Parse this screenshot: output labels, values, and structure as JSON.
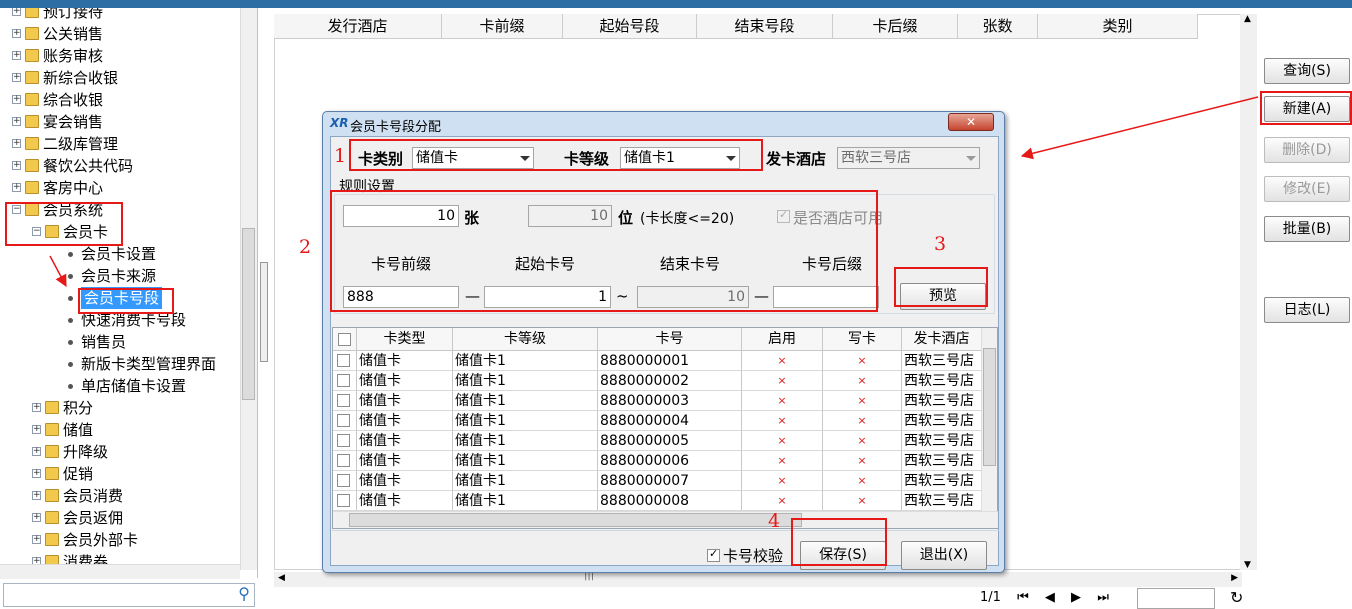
{
  "tree": {
    "items": [
      {
        "label": "预订接待",
        "kind": "folder"
      },
      {
        "label": "公关销售",
        "kind": "folder"
      },
      {
        "label": "账务审核",
        "kind": "folder"
      },
      {
        "label": "新综合收银",
        "kind": "folder"
      },
      {
        "label": "综合收银",
        "kind": "folder"
      },
      {
        "label": "宴会销售",
        "kind": "folder"
      },
      {
        "label": "二级库管理",
        "kind": "folder"
      },
      {
        "label": "餐饮公共代码",
        "kind": "folder"
      },
      {
        "label": "客房中心",
        "kind": "folder"
      },
      {
        "label": "会员系统",
        "kind": "folder"
      },
      {
        "label": "会员卡",
        "kind": "folder"
      },
      {
        "label": "会员卡设置",
        "kind": "leaf"
      },
      {
        "label": "会员卡来源",
        "kind": "leaf"
      },
      {
        "label": "会员卡号段",
        "kind": "leaf"
      },
      {
        "label": "快速消费卡号段",
        "kind": "leaf"
      },
      {
        "label": "销售员",
        "kind": "leaf"
      },
      {
        "label": "新版卡类型管理界面",
        "kind": "leaf"
      },
      {
        "label": "单店储值卡设置",
        "kind": "leaf"
      },
      {
        "label": "积分",
        "kind": "folder"
      },
      {
        "label": "储值",
        "kind": "folder"
      },
      {
        "label": "升降级",
        "kind": "folder"
      },
      {
        "label": "促销",
        "kind": "folder"
      },
      {
        "label": "会员消费",
        "kind": "folder"
      },
      {
        "label": "会员返佣",
        "kind": "folder"
      },
      {
        "label": "会员外部卡",
        "kind": "folder"
      },
      {
        "label": "消费券",
        "kind": "folder"
      }
    ],
    "search_placeholder": ""
  },
  "grid": {
    "columns": [
      "发行酒店",
      "卡前缀",
      "起始号段",
      "结束号段",
      "卡后缀",
      "张数",
      "类别"
    ]
  },
  "side_buttons": {
    "query": "查询(S)",
    "new": "新建(A)",
    "delete": "删除(D)",
    "modify": "修改(E)",
    "batch": "批量(B)",
    "log": "日志(L)"
  },
  "pager": {
    "page": "1/1",
    "first": "⏮",
    "prev": "◀",
    "next": "▶",
    "last": "⏭",
    "refresh": "↻"
  },
  "dialog": {
    "title": "会员卡号段分配",
    "logo": "XR",
    "card_type_label": "卡类别",
    "card_type_value": "储值卡",
    "card_level_label": "卡等级",
    "card_level_value": "储值卡1",
    "hotel_label": "发卡酒店",
    "hotel_value": "西软三号店",
    "rules_label": "规则设置",
    "count_value": "10",
    "count_unit": "张",
    "digits_value": "10",
    "digits_unit": "位",
    "digits_note": "(卡长度<=20)",
    "hotel_available_label": "是否酒店可用",
    "prefix_label": "卡号前缀",
    "start_label": "起始卡号",
    "end_label": "结束卡号",
    "suffix_label": "卡号后缀",
    "prefix_value": "888",
    "start_value": "1",
    "end_value": "10",
    "suffix_value": "",
    "dash": "—",
    "tilde": "~",
    "preview_button": "预览",
    "verify_label": "卡号校验",
    "save_button": "保存(S)",
    "exit_button": "退出(X)",
    "table": {
      "columns": [
        "卡类型",
        "卡等级",
        "卡号",
        "启用",
        "写卡",
        "发卡酒店"
      ],
      "rows": [
        [
          "储值卡",
          "储值卡1",
          "8880000001",
          "×",
          "×",
          "西软三号店"
        ],
        [
          "储值卡",
          "储值卡1",
          "8880000002",
          "×",
          "×",
          "西软三号店"
        ],
        [
          "储值卡",
          "储值卡1",
          "8880000003",
          "×",
          "×",
          "西软三号店"
        ],
        [
          "储值卡",
          "储值卡1",
          "8880000004",
          "×",
          "×",
          "西软三号店"
        ],
        [
          "储值卡",
          "储值卡1",
          "8880000005",
          "×",
          "×",
          "西软三号店"
        ],
        [
          "储值卡",
          "储值卡1",
          "8880000006",
          "×",
          "×",
          "西软三号店"
        ],
        [
          "储值卡",
          "储值卡1",
          "8880000007",
          "×",
          "×",
          "西软三号店"
        ],
        [
          "储值卡",
          "储值卡1",
          "8880000008",
          "×",
          "×",
          "西软三号店"
        ]
      ]
    }
  },
  "annotations": {
    "n1": "1",
    "n2": "2",
    "n3": "3",
    "n4": "4"
  },
  "colors": {
    "annotation": "#e61919",
    "selection": "#3399ff",
    "titlebar": "#2d6fa4"
  }
}
